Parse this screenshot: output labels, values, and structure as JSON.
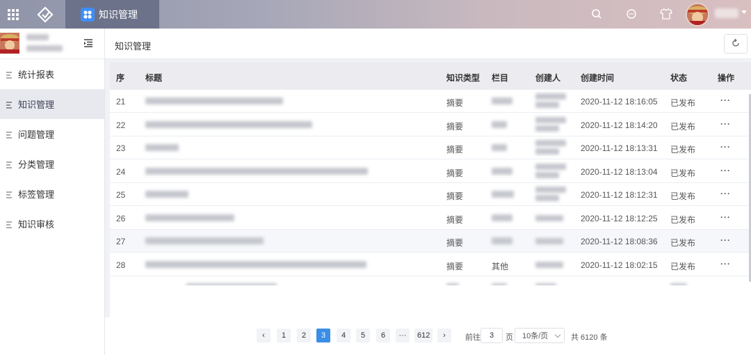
{
  "topbar": {
    "app_tab_label": "知识管理",
    "icons": [
      "apps-grid-icon",
      "logo-icon",
      "search-icon",
      "chat-icon",
      "shirt-icon"
    ]
  },
  "sidebar": {
    "items": [
      {
        "label": "统计报表",
        "active": false
      },
      {
        "label": "知识管理",
        "active": true
      },
      {
        "label": "问题管理",
        "active": false
      },
      {
        "label": "分类管理",
        "active": false
      },
      {
        "label": "标签管理",
        "active": false
      },
      {
        "label": "知识审核",
        "active": false
      }
    ]
  },
  "page": {
    "title": "知识管理"
  },
  "table": {
    "headers": {
      "index": "序",
      "title": "标题",
      "type": "知识类型",
      "column": "栏目",
      "creator": "创建人",
      "created_at": "创建时间",
      "status": "状态",
      "ops": "操作"
    },
    "rows": [
      {
        "index": "21",
        "type": "摘要",
        "column": "",
        "created_at": "2020-11-12 18:16:05",
        "status": "已发布",
        "ops": "···"
      },
      {
        "index": "22",
        "type": "摘要",
        "column": "",
        "created_at": "2020-11-12 18:14:20",
        "status": "已发布",
        "ops": "···"
      },
      {
        "index": "23",
        "type": "摘要",
        "column": "",
        "created_at": "2020-11-12 18:13:31",
        "status": "已发布",
        "ops": "···"
      },
      {
        "index": "24",
        "type": "摘要",
        "column": "",
        "created_at": "2020-11-12 18:13:04",
        "status": "已发布",
        "ops": "···"
      },
      {
        "index": "25",
        "type": "摘要",
        "column": "",
        "created_at": "2020-11-12 18:12:31",
        "status": "已发布",
        "ops": "···"
      },
      {
        "index": "26",
        "type": "摘要",
        "column": "",
        "created_at": "2020-11-12 18:12:25",
        "status": "已发布",
        "ops": "···"
      },
      {
        "index": "27",
        "type": "摘要",
        "column": "",
        "created_at": "2020-11-12 18:08:36",
        "status": "已发布",
        "ops": "···"
      },
      {
        "index": "28",
        "type": "摘要",
        "column": "其他",
        "created_at": "2020-11-12 18:02:15",
        "status": "已发布",
        "ops": "···"
      }
    ]
  },
  "pager": {
    "prev": "‹",
    "pages": [
      "1",
      "2",
      "3",
      "4",
      "5",
      "6"
    ],
    "current": "3",
    "ellipsis": "···",
    "last": "612",
    "next": "›",
    "goto_label": "前往",
    "goto_value": "3",
    "goto_suffix": "页",
    "page_size": "10条/页",
    "total": "共 6120 条"
  },
  "colors": {
    "accent": "#3a8ee6",
    "app_tab_bg": "#6b7289",
    "app_icon": "#3e8ef7"
  }
}
